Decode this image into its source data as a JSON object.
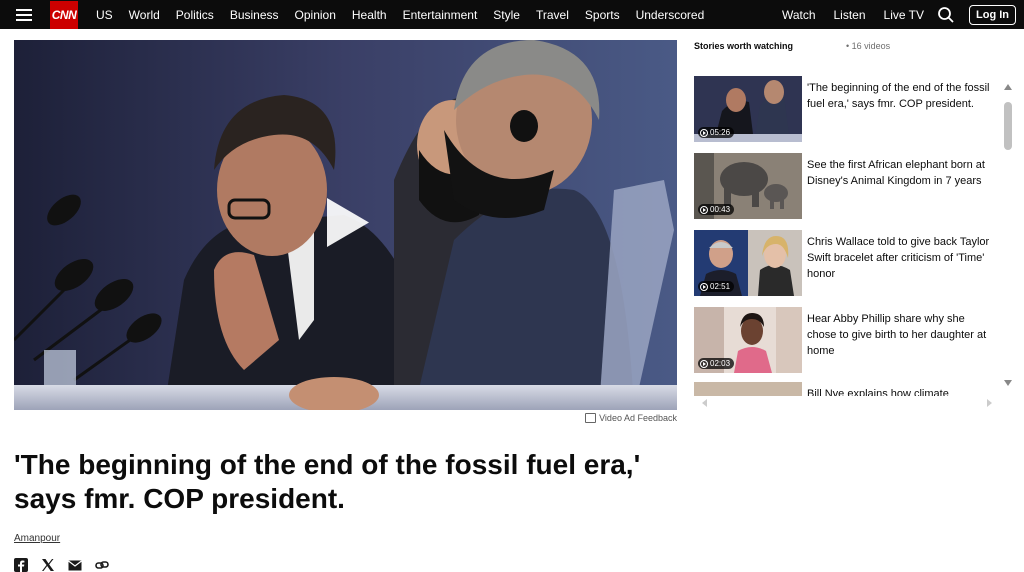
{
  "nav": {
    "logo": "CNN",
    "items": [
      "US",
      "World",
      "Politics",
      "Business",
      "Opinion",
      "Health",
      "Entertainment",
      "Style",
      "Travel",
      "Sports",
      "Underscored"
    ],
    "right_items": [
      "Watch",
      "Listen",
      "Live TV"
    ],
    "login_label": "Log In"
  },
  "video": {
    "ad_feedback": "Video Ad Feedback"
  },
  "article": {
    "headline": "'The beginning of the end of the fossil fuel era,' says fmr. COP president.",
    "byline": "Amanpour"
  },
  "sidebar": {
    "title": "Stories worth watching",
    "count": "• 16 videos",
    "items": [
      {
        "title": "'The beginning of the end of the fossil fuel era,' says fmr. COP president.",
        "duration": "05:26"
      },
      {
        "title": "See the first African elephant born at Disney's Animal Kingdom in 7 years",
        "duration": "00:43"
      },
      {
        "title": "Chris Wallace told to give back Taylor Swift bracelet after criticism of 'Time' honor",
        "duration": "02:51"
      },
      {
        "title": "Hear Abby Phillip share why she chose to give birth to her daughter at home",
        "duration": "02:03"
      },
      {
        "title": "Bill Nye explains how climate",
        "duration": ""
      }
    ]
  },
  "colors": {
    "nav_bg": "#0c0c0c",
    "brand_red": "#cc0000"
  }
}
